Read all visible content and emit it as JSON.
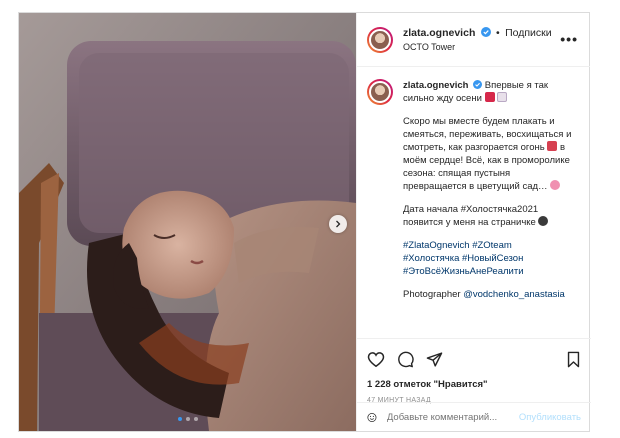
{
  "post": {
    "username": "zlata.ognevich",
    "follow_label": "Подписки",
    "location": "OCTO Tower",
    "more_label": "•••",
    "media_dots": 3,
    "media_active_dot": 0
  },
  "caption": {
    "username": "zlata.ognevich",
    "first_line": "Впервые я так сильно жду осени",
    "para1": "Скоро мы вместе будем плакать и смеяться, переживать, восхищаться и смотреть, как разгорается огонь",
    "para1b": "в моём сердце! Всё, как в проморолике сезона: спящая пустыня превращается в цветущий сад…",
    "para2": "Дата начала #Холостячка2021 появится у меня на страничке",
    "hashtags": [
      "#ZlataOgnevich",
      "#ZOteam",
      "#Холостячка",
      "#НовыйСезон",
      "#ЭтоВсёЖизньАнеРеалити"
    ],
    "photographer_label": "Photographer",
    "photographer_handle": "@vodchenko_anastasia"
  },
  "actions": {
    "likes_count": "1 228",
    "likes_text": "отметок \"Нравится\"",
    "time": "47 МИНУТ НАЗАД"
  },
  "comment": {
    "placeholder": "Добавьте комментарий...",
    "publish_label": "Опубликовать"
  },
  "colors": {
    "link": "#00376b",
    "verified": "#3897f0",
    "publish_disabled": "#b2dffc",
    "muted": "#8e8e8e"
  }
}
